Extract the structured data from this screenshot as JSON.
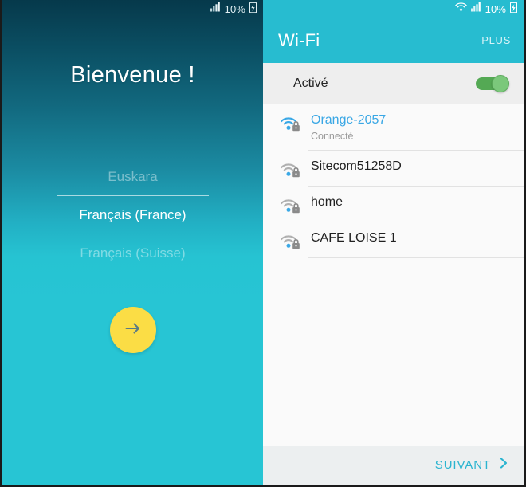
{
  "left_screen": {
    "status_bar": {
      "battery_text": "10%",
      "icons": [
        "signal-icon",
        "battery-charging-icon"
      ]
    },
    "title": "Bienvenue !",
    "languages": [
      {
        "label": "Euskara",
        "selected": false
      },
      {
        "label": "Français (France)",
        "selected": true
      },
      {
        "label": "Français (Suisse)",
        "selected": false
      }
    ],
    "next_button": {
      "icon": "arrow-right-icon",
      "color": "#fbdd45",
      "arrow_color": "#5a7a84"
    }
  },
  "right_screen": {
    "status_bar": {
      "battery_text": "10%",
      "icons": [
        "wifi-icon",
        "signal-icon",
        "battery-charging-icon"
      ]
    },
    "app_bar": {
      "title": "Wi-Fi",
      "action_label": "PLUS",
      "background": "#27bcd0"
    },
    "toggle": {
      "label": "Activé",
      "state": "on",
      "track_color": "#54a954",
      "thumb_color": "#7bc87b"
    },
    "networks": [
      {
        "name": "Orange-2057",
        "status": "Connecté",
        "secured": true,
        "connected": true
      },
      {
        "name": "Sitecom51258D",
        "status": "",
        "secured": true,
        "connected": false
      },
      {
        "name": "home",
        "status": "",
        "secured": true,
        "connected": false
      },
      {
        "name": "CAFE LOISE 1",
        "status": "",
        "secured": true,
        "connected": false
      }
    ],
    "bottom_bar": {
      "next_label": "SUIVANT",
      "next_icon": "chevron-right-icon",
      "accent": "#2ab4d0"
    }
  }
}
